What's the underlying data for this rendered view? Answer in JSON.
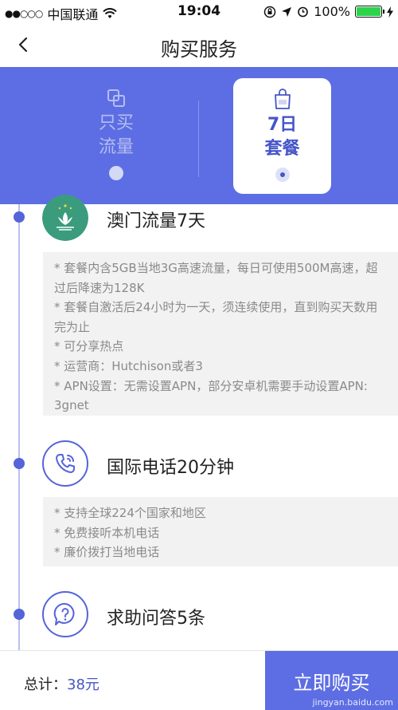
{
  "status_bar": {
    "signal": "●●○○○",
    "carrier": "中国联通",
    "time": "19:04",
    "battery": "100%"
  },
  "nav": {
    "title": "购买服务"
  },
  "options": [
    {
      "line1": "只买",
      "line2": "流量",
      "selected": false
    },
    {
      "line1": "7日",
      "line2": "套餐",
      "selected": true
    }
  ],
  "sections": [
    {
      "title": "澳门流量7天",
      "details": [
        "* 套餐内含5GB当地3G高速流量，每日可使用500M高速，超过后降速为128K",
        "* 套餐自激活后24小时为一天，须连续使用，直到购买天数用完为止",
        "* 可分享热点",
        "* 运营商：Hutchison或者3",
        "* APN设置：无需设置APN，部分安卓机需要手动设置APN: 3gnet"
      ]
    },
    {
      "title": "国际电话20分钟",
      "details": [
        "* 支持全球224个国家和地区",
        "* 免费接听本机电话",
        "* 廉价拨打当地电话"
      ]
    },
    {
      "title": "求助问答5条",
      "details": []
    }
  ],
  "footer": {
    "total_label": "总计：",
    "total_price": "38元",
    "buy_label": "立即购买",
    "watermark": "jingyan.baidu.com"
  },
  "colors": {
    "accent": "#5d6ee4",
    "accent_dark": "#4655c8",
    "battery": "#2bd44a",
    "macau_icon": "#3a9c7c"
  }
}
